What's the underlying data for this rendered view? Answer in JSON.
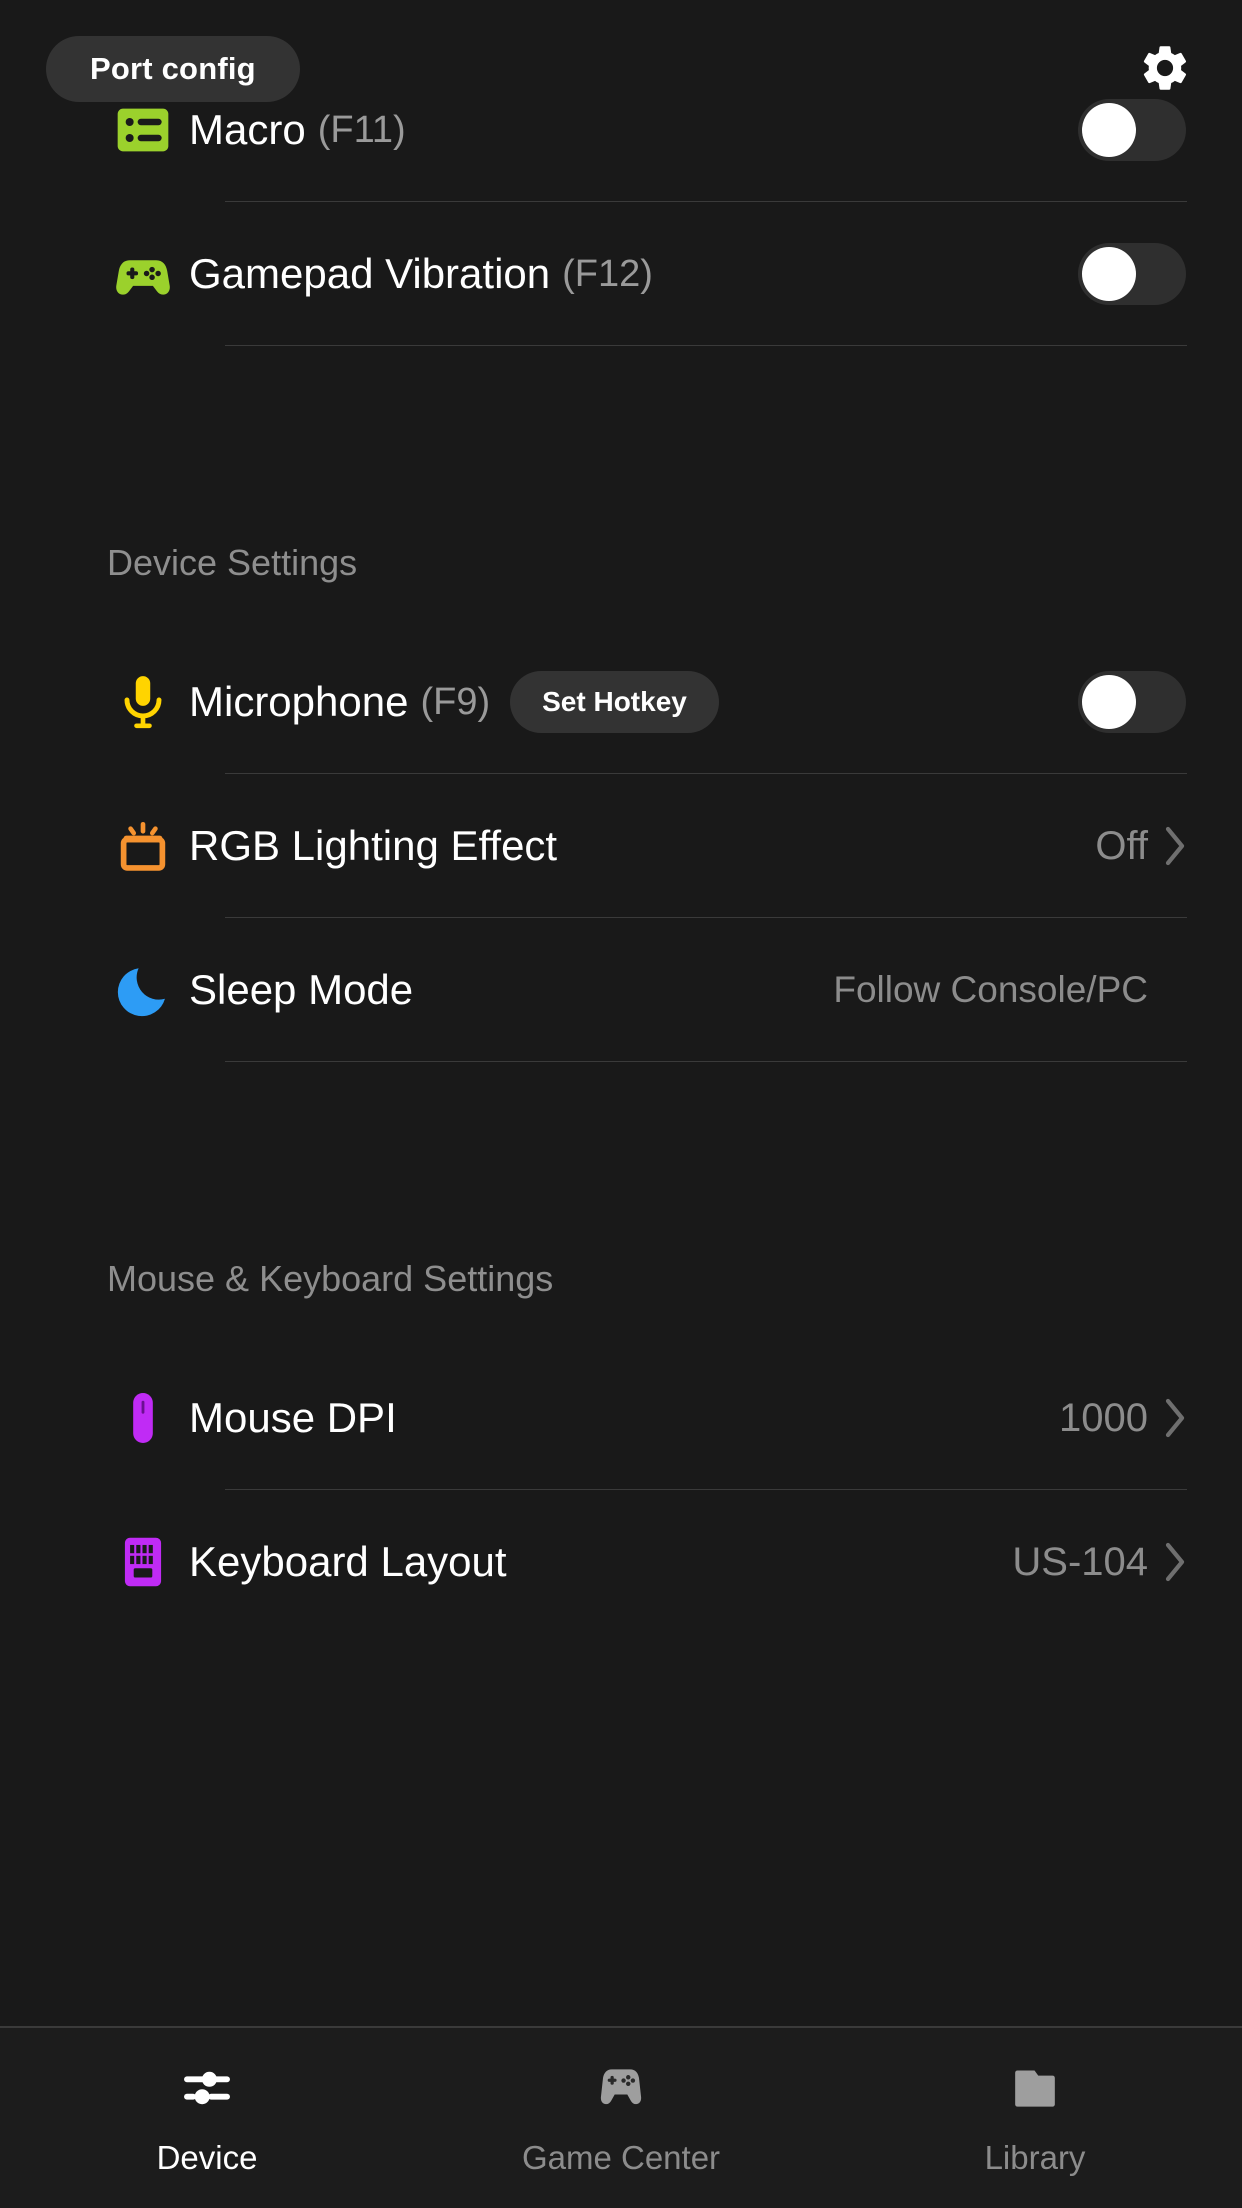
{
  "header": {
    "port_config_label": "Port config",
    "gear_icon": "gear-icon"
  },
  "sections": [
    {
      "title": "",
      "rows": [
        {
          "id": "macro",
          "icon": "macro-list-icon",
          "icon_color": "#9BD12C",
          "label": "Macro",
          "hotkey": "(F11)",
          "control": "toggle",
          "toggle_state": "off"
        },
        {
          "id": "gamepad-vibration",
          "icon": "gamepad-icon",
          "icon_color": "#9BD12C",
          "label": "Gamepad Vibration",
          "hotkey": "(F12)",
          "control": "toggle",
          "toggle_state": "off"
        }
      ]
    },
    {
      "title": "Device Settings",
      "rows": [
        {
          "id": "microphone",
          "icon": "microphone-icon",
          "icon_color": "#FFD400",
          "label": "Microphone",
          "hotkey": "(F9)",
          "button_label": "Set Hotkey",
          "control": "toggle",
          "toggle_state": "off"
        },
        {
          "id": "rgb-lighting-effect",
          "icon": "rgb-lamp-icon",
          "icon_color": "#F5922F",
          "label": "RGB Lighting Effect",
          "value": "Off",
          "control": "chevron"
        },
        {
          "id": "sleep-mode",
          "icon": "moon-icon",
          "icon_color": "#2D9CF5",
          "label": "Sleep Mode",
          "value": "Follow Console/PC",
          "control": "none"
        }
      ]
    },
    {
      "title": "Mouse & Keyboard Settings",
      "rows": [
        {
          "id": "mouse-dpi",
          "icon": "mouse-icon",
          "icon_color": "#C02BF5",
          "label": "Mouse DPI",
          "value": "1000",
          "control": "chevron"
        },
        {
          "id": "keyboard-layout",
          "icon": "keyboard-icon",
          "icon_color": "#C02BF5",
          "label": "Keyboard Layout",
          "value": "US-104",
          "control": "chevron"
        }
      ]
    }
  ],
  "tabbar": {
    "items": [
      {
        "id": "device",
        "label": "Device",
        "icon": "sliders-icon",
        "active": true
      },
      {
        "id": "game-center",
        "label": "Game Center",
        "icon": "gamepad-icon",
        "active": false
      },
      {
        "id": "library",
        "label": "Library",
        "icon": "folder-icon",
        "active": false
      }
    ]
  },
  "colors": {
    "background": "#191919",
    "pill": "#333333",
    "divider": "#3a3a3a",
    "text_primary": "#ffffff",
    "text_secondary": "#8c8c8c"
  }
}
